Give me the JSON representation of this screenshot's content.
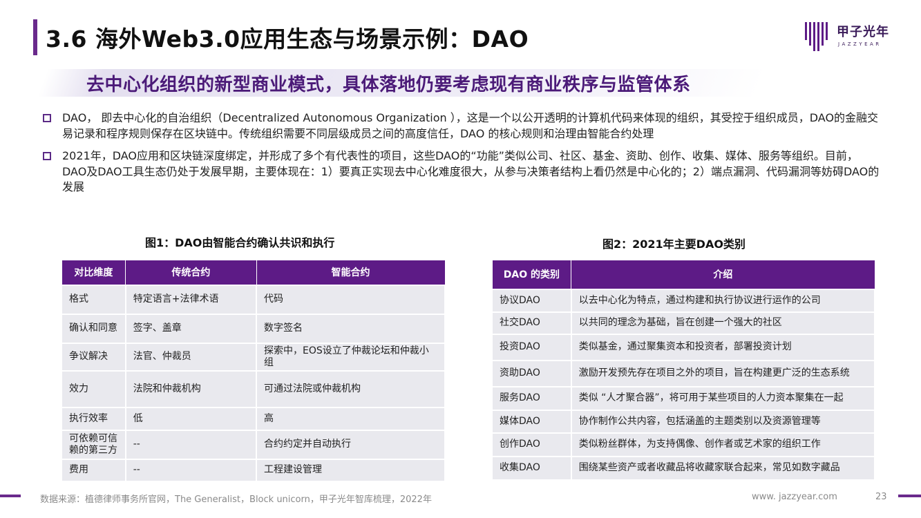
{
  "header": {
    "title": "3.6 海外Web3.0应用生态与场景示例：DAO",
    "logo_cn": "甲子光年",
    "logo_en": "JAZZYEAR"
  },
  "subtitle": "去中心化组织的新型商业模式，具体落地仍要考虑现有商业秩序与监管体系",
  "bullets": [
    "DAO， 即去中心化的自治组织（Decentralized Autonomous Organization ），这是一个以公开透明的计算机代码来体现的组织，其受控于组织成员，DAO的金融交易记录和程序规则保存在区块链中。传统组织需要不同层级成员之间的高度信任，DAO 的核心规则和治理由智能合约处理",
    "2021年，DAO应用和区块链深度绑定，并形成了多个有代表性的项目，这些DAO的“功能”类似公司、社区、基金、资助、创作、收集、媒体、服务等组织。目前，DAO及DAO工具生态仍处于发展早期，主要体现在：1）要真正实现去中心化难度很大，从参与决策者结构上看仍然是中心化的；2）端点漏洞、代码漏洞等妨碍DAO的发展"
  ],
  "figure1": {
    "title": "图1：DAO由智能合约确认共识和执行",
    "headers": [
      "对比维度",
      "传统合约",
      "智能合约"
    ],
    "rows": [
      [
        "格式",
        "特定语言+法律术语",
        "代码"
      ],
      [
        "确认和同意",
        "签字、盖章",
        "数字签名"
      ],
      [
        "争议解决",
        "法官、仲裁员",
        "探索中，EOS设立了仲裁论坛和仲裁小组"
      ],
      [
        "效力",
        "法院和仲裁机构",
        "可通过法院或仲裁机构"
      ],
      [
        "执行效率",
        "低",
        "高"
      ],
      [
        "可依赖可信赖的第三方",
        "--",
        "合约约定并自动执行"
      ],
      [
        "费用",
        "--",
        "工程建设管理"
      ]
    ]
  },
  "figure2": {
    "title": "图2：2021年主要DAO类别",
    "headers": [
      "DAO 的类别",
      "介绍"
    ],
    "rows": [
      [
        "协议DAO",
        "以去中心化为特点，通过构建和执行协议进行运作的公司"
      ],
      [
        "社交DAO",
        "以共同的理念为基础，旨在创建一个强大的社区"
      ],
      [
        "投资DAO",
        "类似基金，通过聚集资本和投资者，部署投资计划"
      ],
      [
        "资助DAO",
        "激励开发预先存在项目之外的项目，旨在构建更广泛的生态系统"
      ],
      [
        "服务DAO",
        "类似 “人才聚合器”，将可用于某些项目的人力资本聚集在一起"
      ],
      [
        "媒体DAO",
        "协作制作公共内容，包括涵盖的主题类别以及资源管理等"
      ],
      [
        "创作DAO",
        "类似粉丝群体，为支持偶像、创作者或艺术家的组织工作"
      ],
      [
        "收集DAO",
        "围绕某些资产或者收藏品将收藏家联合起来，常见如数字藏品"
      ]
    ]
  },
  "footer": {
    "source": "数据来源：植德律师事务所官网，The Generalist，Block unicorn，甲子光年智库梳理，2022年",
    "url": "www. jazzyear.com",
    "page": "23"
  },
  "colors": {
    "brand": "#5d1b86",
    "cell_bg": "#e9e9ee",
    "subtitle": "#4b1a78"
  }
}
